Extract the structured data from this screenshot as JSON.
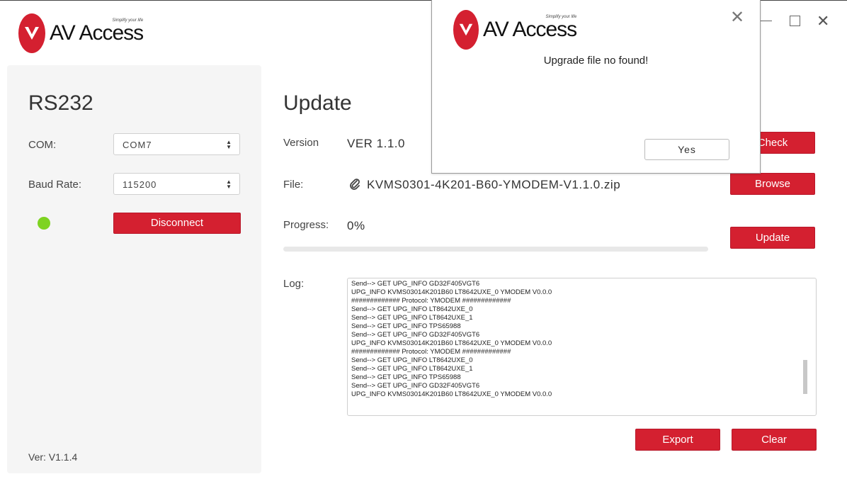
{
  "app": {
    "logo_text": "AV Access",
    "logo_tagline": "Simplify your life",
    "window_controls": [
      "minimize",
      "maximize",
      "close"
    ]
  },
  "rs232": {
    "title": "RS232",
    "com_label": "COM:",
    "com_value": "COM7",
    "baud_label": "Baud Rate:",
    "baud_value": "115200",
    "status_color": "#7ed321",
    "disconnect_label": "Disconnect",
    "version_text": "Ver: V1.1.4"
  },
  "update": {
    "title": "Update",
    "version_label": "Version",
    "version_value": "VER 1.1.0",
    "check_label": "Check",
    "file_label": "File:",
    "file_value": "KVMS0301-4K201-B60-YMODEM-V1.1.0.zip",
    "browse_label": "Browse",
    "progress_label": "Progress:",
    "progress_value": "0%",
    "progress_fraction": 0,
    "update_label": "Update",
    "log_label": "Log:",
    "log_lines": [
      "Send--> GET UPG_INFO GD32F405VGT6",
      "UPG_INFO KVMS03014K201B60 LT8642UXE_0 YMODEM V0.0.0",
      "############# Protocol: YMODEM #############",
      "Send--> GET UPG_INFO LT8642UXE_0",
      "Send--> GET UPG_INFO LT8642UXE_1",
      "Send--> GET UPG_INFO TPS65988",
      "Send--> GET UPG_INFO GD32F405VGT6",
      "UPG_INFO KVMS03014K201B60 LT8642UXE_0 YMODEM V0.0.0",
      "############# Protocol: YMODEM #############",
      "Send--> GET UPG_INFO LT8642UXE_0",
      "Send--> GET UPG_INFO LT8642UXE_1",
      "Send--> GET UPG_INFO TPS65988",
      "Send--> GET UPG_INFO GD32F405VGT6",
      "UPG_INFO KVMS03014K201B60 LT8642UXE_0 YMODEM V0.0.0"
    ],
    "export_label": "Export",
    "clear_label": "Clear"
  },
  "dialog": {
    "message": "Upgrade file no found!",
    "yes_label": "Yes"
  },
  "colors": {
    "accent": "#d42030",
    "panel_bg": "#f5f5f5",
    "status_connected": "#7ed321"
  }
}
